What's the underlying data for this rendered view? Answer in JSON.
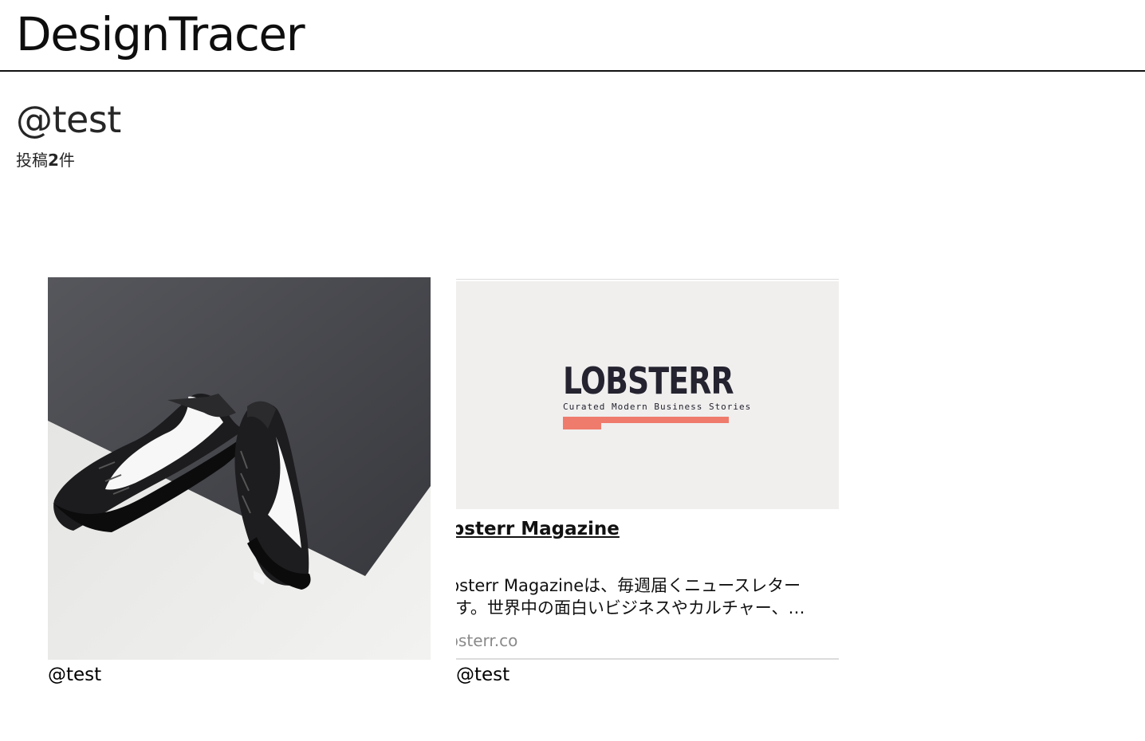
{
  "header": {
    "brand": "DesignTracer"
  },
  "profile": {
    "username": "@test",
    "post_count_prefix": "投稿",
    "post_count_value": "2",
    "post_count_suffix": "件"
  },
  "posts": [
    {
      "type": "image",
      "author": "@test"
    },
    {
      "type": "link",
      "thumbnail_logo": "LOBSTERR",
      "thumbnail_tagline": "Curated Modern Business Stories",
      "title": "obsterr Magazine",
      "description_line1": "obsterr Magazineは、毎週届くニュースレター",
      "description_line2": "です。世界中の面白いビジネスやカルチャー、…",
      "domain": "obsterr.co",
      "author": "@test"
    }
  ],
  "colors": {
    "accent": "#ef7b6c",
    "logo_ink": "#24232f"
  }
}
